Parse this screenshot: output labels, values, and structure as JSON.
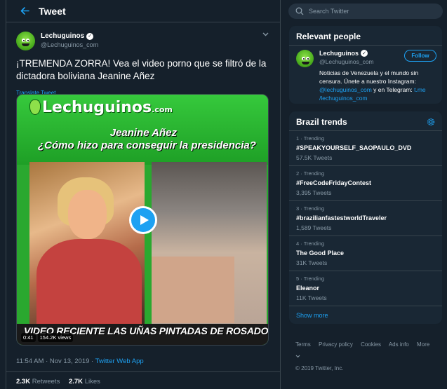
{
  "header": {
    "title": "Tweet"
  },
  "tweet": {
    "author": {
      "name": "Lechuguinos",
      "handle": "@Lechuguinos_com"
    },
    "text": "¡TREMENDA ZORRA! Vea el video porno que se filtró de la dictadora boliviana Jeanine Añez",
    "translate_label": "Translate Tweet",
    "media": {
      "logo_text": "Lechuguinos",
      "logo_suffix": ".com",
      "headline_1": "Jeanine Añez",
      "headline_2": "¿Cómo hizo para conseguir la presidencia?",
      "caption": "VIDEO RECIENTE LAS UÑAS PINTADAS DE ROSADO",
      "duration": "0:41",
      "views": "154.2K views"
    },
    "timestamp": "11:54 AM · Nov 13, 2019 · ",
    "source": "Twitter Web App",
    "retweets_count": "2.3K",
    "retweets_label": "Retweets",
    "likes_count": "2.7K",
    "likes_label": "Likes"
  },
  "search": {
    "placeholder": "Search Twitter"
  },
  "relevant_people": {
    "title": "Relevant people",
    "person": {
      "name": "Lechuguinos",
      "handle": "@Lechuguinos_com",
      "follow_label": "Follow",
      "bio_1": "Noticias de Venezuela y el mundo sin censura. Únete a nuestro Instagram: ",
      "bio_link_1": "@lechuguinos_com",
      "bio_2": " y en Telegram: ",
      "bio_link_2": "t.me /lechuguinos_com"
    }
  },
  "trends": {
    "title": "Brazil trends",
    "items": [
      {
        "meta": "1 · Trending",
        "name": "#SPEAKYOURSELF_SAOPAULO_DVD",
        "count": "57.5K Tweets"
      },
      {
        "meta": "2 · Trending",
        "name": "#FreeCodeFridayContest",
        "count": "3,395 Tweets"
      },
      {
        "meta": "3 · Trending",
        "name": "#brazilianfastestworldTraveler",
        "count": "1,589 Tweets"
      },
      {
        "meta": "4 · Trending",
        "name": "The Good Place",
        "count": "31K Tweets"
      },
      {
        "meta": "5 · Trending",
        "name": "Eleanor",
        "count": "11K Tweets"
      }
    ],
    "show_more": "Show more"
  },
  "footer": {
    "links": [
      "Terms",
      "Privacy policy",
      "Cookies",
      "Ads info",
      "More"
    ],
    "copyright": "© 2019 Twitter, Inc."
  },
  "colors": {
    "accent": "#1da1f2",
    "background": "#15202b",
    "card": "#192734",
    "muted": "#8899a6"
  }
}
